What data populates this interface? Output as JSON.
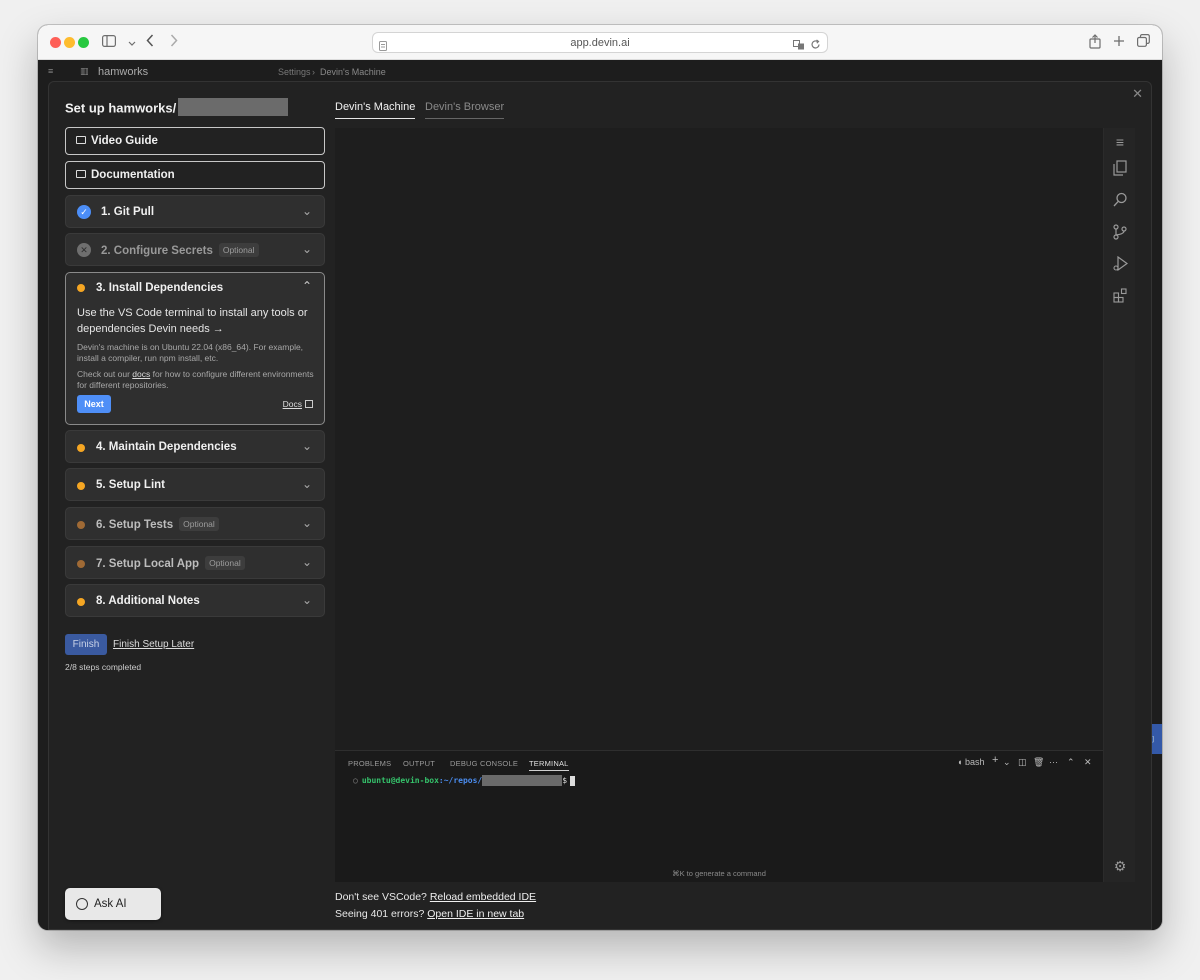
{
  "browser": {
    "url": "app.devin.ai",
    "icons": [
      "sidebar-icon",
      "back-icon",
      "forward-icon",
      "share-icon",
      "new-tab-icon",
      "tabs-icon",
      "translate-icon",
      "reload-icon"
    ]
  },
  "background": {
    "workspace": "hamworks",
    "breadcrumb": [
      "Settings",
      "Devin's Machine"
    ]
  },
  "setup": {
    "title": "Set up hamworks/",
    "video_guide": "Video Guide",
    "documentation": "Documentation",
    "steps": [
      {
        "label": "1. Git Pull",
        "status": "done",
        "optional": false
      },
      {
        "label": "2. Configure Secrets",
        "status": "skipped",
        "optional": true
      },
      {
        "label": "3. Install Dependencies",
        "status": "pending",
        "optional": false
      },
      {
        "label": "4. Maintain Dependencies",
        "status": "pending",
        "optional": false
      },
      {
        "label": "5. Setup Lint",
        "status": "pending",
        "optional": false
      },
      {
        "label": "6. Setup Tests",
        "status": "pending-optional",
        "optional": true
      },
      {
        "label": "7. Setup Local App",
        "status": "pending-optional",
        "optional": true
      },
      {
        "label": "8. Additional Notes",
        "status": "pending",
        "optional": false
      }
    ],
    "optional_tag": "Optional",
    "expanded": {
      "lead": "Use the VS Code terminal to install any tools or dependencies Devin needs →",
      "note1": "Devin's machine is on Ubuntu 22.04 (x86_64). For example, install a compiler, run npm install, etc.",
      "note2_prefix": "Check out our ",
      "note2_link": "docs",
      "note2_suffix": " for how to configure different environments for different repositories.",
      "next": "Next",
      "docs": "Docs"
    },
    "finish": "Finish",
    "finish_later": "Finish Setup Later",
    "progress": "2/8 steps completed",
    "ask_ai": "Ask AI"
  },
  "tabs": [
    "Devin's Machine",
    "Devin's Browser"
  ],
  "ide": {
    "panel_tabs": [
      "PROBLEMS",
      "OUTPUT",
      "DEBUG CONSOLE",
      "TERMINAL"
    ],
    "shell": "bash",
    "prompt_user": "ubuntu@devin-box",
    "prompt_path": ":~/repos/",
    "prompt_symbol": "$",
    "generate_hint": "⌘K to generate a command"
  },
  "help": {
    "line1_text": "Don't see VSCode?",
    "line1_link": "Reload embedded IDE",
    "line2_text": "Seeing 401 errors?",
    "line2_link": "Open IDE in new tab"
  },
  "colors": {
    "accent_blue": "#4f8ff7",
    "pending_orange": "#f5a623",
    "pending_optional": "#a06a35",
    "terminal_user": "#35c26b"
  }
}
